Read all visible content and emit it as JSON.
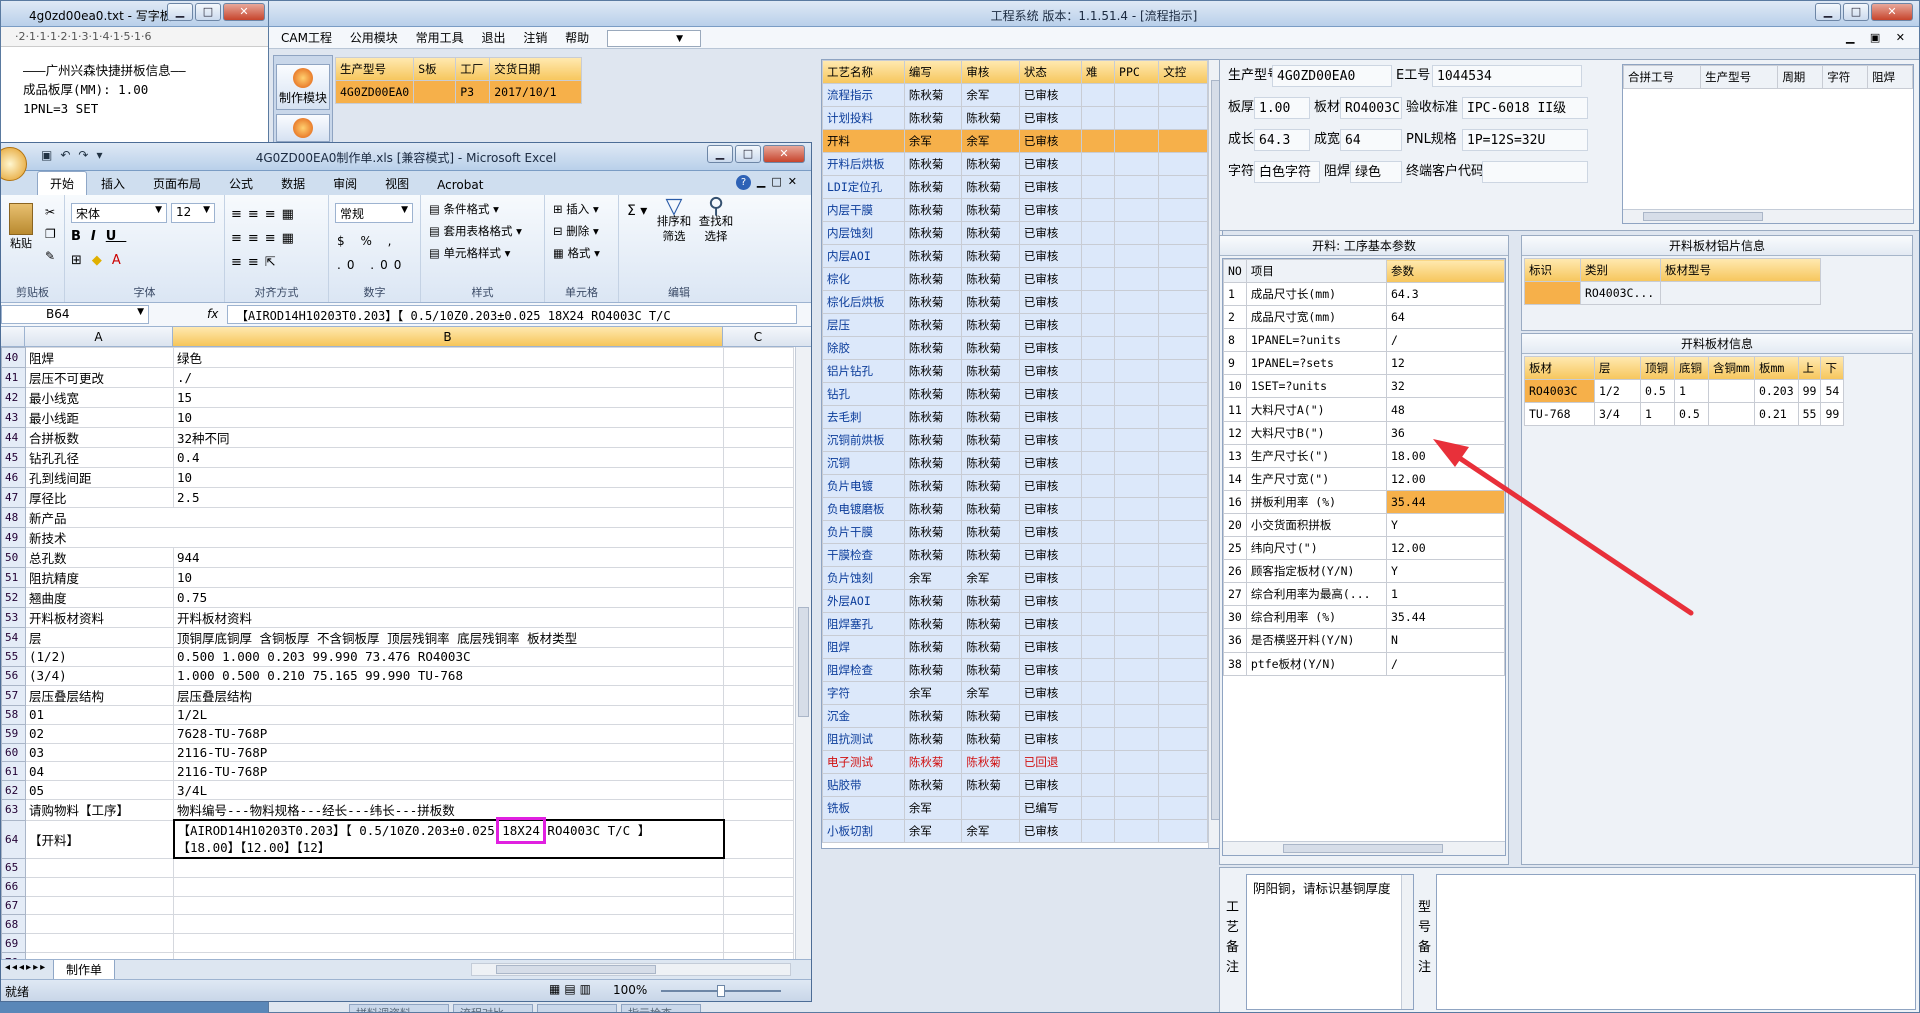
{
  "notepad": {
    "title": "4g0zd00ea0.txt - 写字板",
    "ruler": "·2·1·1·1·2·1·3·1·4·1·5·1·6",
    "lines": [
      "———广州兴森快捷拼板信息——",
      "成品板厚(MM): 1.00",
      "1PNL=3 SET"
    ]
  },
  "app": {
    "title": "工程系统   版本：1.1.51.4 - [流程指示]",
    "menu": [
      "CAM工程",
      "公用模块",
      "常用工具",
      "退出",
      "注销",
      "帮助"
    ],
    "side_btn": "制作模块",
    "jobs": {
      "headers": [
        "生产型号",
        "S板",
        "工厂",
        "交货日期"
      ],
      "row": [
        "4G0ZD00EA0",
        "",
        "P3",
        "2017/10/1"
      ]
    },
    "process": {
      "headers": [
        "工艺名称",
        "编写",
        "审核",
        "状态",
        "难",
        "PPC",
        "文控"
      ],
      "rows": [
        [
          "流程指示",
          "陈秋菊",
          "余军",
          "已审核"
        ],
        [
          "计划投料",
          "陈秋菊",
          "陈秋菊",
          "已审核"
        ],
        [
          "开料",
          "余军",
          "余军",
          "已审核"
        ],
        [
          "开料后烘板",
          "陈秋菊",
          "陈秋菊",
          "已审核"
        ],
        [
          "LDI定位孔",
          "陈秋菊",
          "陈秋菊",
          "已审核"
        ],
        [
          "内层干膜",
          "陈秋菊",
          "陈秋菊",
          "已审核"
        ],
        [
          "内层蚀刻",
          "陈秋菊",
          "陈秋菊",
          "已审核"
        ],
        [
          "内层AOI",
          "陈秋菊",
          "陈秋菊",
          "已审核"
        ],
        [
          "棕化",
          "陈秋菊",
          "陈秋菊",
          "已审核"
        ],
        [
          "棕化后烘板",
          "陈秋菊",
          "陈秋菊",
          "已审核"
        ],
        [
          "层压",
          "陈秋菊",
          "陈秋菊",
          "已审核"
        ],
        [
          "除胶",
          "陈秋菊",
          "陈秋菊",
          "已审核"
        ],
        [
          "铝片钻孔",
          "陈秋菊",
          "陈秋菊",
          "已审核"
        ],
        [
          "钻孔",
          "陈秋菊",
          "陈秋菊",
          "已审核"
        ],
        [
          "去毛刺",
          "陈秋菊",
          "陈秋菊",
          "已审核"
        ],
        [
          "沉铜前烘板",
          "陈秋菊",
          "陈秋菊",
          "已审核"
        ],
        [
          "沉铜",
          "陈秋菊",
          "陈秋菊",
          "已审核"
        ],
        [
          "负片电镀",
          "陈秋菊",
          "陈秋菊",
          "已审核"
        ],
        [
          "负电镀磨板",
          "陈秋菊",
          "陈秋菊",
          "已审核"
        ],
        [
          "负片干膜",
          "陈秋菊",
          "陈秋菊",
          "已审核"
        ],
        [
          "干膜检查",
          "陈秋菊",
          "陈秋菊",
          "已审核"
        ],
        [
          "负片蚀刻",
          "余军",
          "余军",
          "已审核"
        ],
        [
          "外层AOI",
          "陈秋菊",
          "陈秋菊",
          "已审核"
        ],
        [
          "阻焊塞孔",
          "陈秋菊",
          "陈秋菊",
          "已审核"
        ],
        [
          "阻焊",
          "陈秋菊",
          "陈秋菊",
          "已审核"
        ],
        [
          "阻焊检查",
          "陈秋菊",
          "陈秋菊",
          "已审核"
        ],
        [
          "字符",
          "余军",
          "余军",
          "已审核"
        ],
        [
          "沉金",
          "陈秋菊",
          "陈秋菊",
          "已审核"
        ],
        [
          "阻抗测试",
          "陈秋菊",
          "陈秋菊",
          "已审核"
        ],
        [
          "电子测试",
          "陈秋菊",
          "陈秋菊",
          "已回退"
        ],
        [
          "贴胶带",
          "陈秋菊",
          "陈秋菊",
          "已审核"
        ],
        [
          "铣板",
          "余军",
          "",
          "已编写"
        ],
        [
          "小板切割",
          "余军",
          "余军",
          "已审核"
        ]
      ]
    },
    "info": {
      "prod_model_label": "生产型号",
      "prod_model": "4G0ZD00EA0",
      "e_no_label": "E工号",
      "e_no": "1044534",
      "thick_label": "板厚",
      "thick": "1.00",
      "mat_label": "板材",
      "mat": "RO4003C",
      "std_label": "验收标准",
      "std": "IPC-6018 II级",
      "len_label": "成长",
      "len": "64.3",
      "wid_label": "成宽",
      "wid": "64",
      "pnl_label": "PNL规格",
      "pnl": "1P=12S=32U",
      "char_label": "字符",
      "char": "白色字符",
      "mask_label": "阻焊",
      "mask": "绿色",
      "cust_label": "终端客户代码",
      "cust": ""
    },
    "panelgrid": {
      "headers": [
        "合拼工号",
        "生产型号",
        "周期",
        "字符",
        "阻焊"
      ]
    },
    "params": {
      "title": "开料: 工序基本参数",
      "headers": [
        "NO",
        "项目",
        "参数"
      ],
      "rows": [
        [
          "1",
          "成品尺寸长(mm)",
          "64.3"
        ],
        [
          "2",
          "成品尺寸宽(mm)",
          "64"
        ],
        [
          "8",
          "1PANEL=?units",
          "/"
        ],
        [
          "9",
          "1PANEL=?sets",
          "12"
        ],
        [
          "10",
          "1SET=?units",
          "32"
        ],
        [
          "11",
          "大料尺寸A(\")",
          "48"
        ],
        [
          "12",
          "大料尺寸B(\")",
          "36"
        ],
        [
          "13",
          "生产尺寸长(\")",
          "18.00"
        ],
        [
          "14",
          "生产尺寸宽(\")",
          "12.00"
        ],
        [
          "16",
          "拼板利用率 (%)",
          "35.44"
        ],
        [
          "20",
          "小交货面积拼板",
          "Y"
        ],
        [
          "25",
          "纬向尺寸(\")",
          "12.00"
        ],
        [
          "26",
          "顾客指定板材(Y/N)",
          "Y"
        ],
        [
          "27",
          "综合利用率为最高(...",
          "1"
        ],
        [
          "30",
          "综合利用率 (%)",
          "35.44"
        ],
        [
          "36",
          "是否横竖开料(Y/N)",
          "N"
        ],
        [
          "38",
          "ptfe板材(Y/N)",
          "/"
        ]
      ]
    },
    "foil": {
      "title": "开料板材铝片信息",
      "headers": [
        "标识",
        "类别",
        "板材型号"
      ],
      "row": [
        "",
        "RO4003C...",
        ""
      ]
    },
    "sheet": {
      "title": "开料板材信息",
      "headers": [
        "板材",
        "层",
        "顶铜",
        "底铜",
        "含铜mm",
        "板mm",
        "上",
        "下"
      ],
      "rows": [
        [
          "RO4003C",
          "1/2",
          "0.5",
          "1",
          "",
          "0.203",
          "99",
          "54"
        ],
        [
          "TU-768",
          "3/4",
          "1",
          "0.5",
          "",
          "0.21",
          "55",
          "99"
        ]
      ]
    },
    "remark": {
      "label": "工艺备注",
      "text": "阴阳铜，请标识基铜厚度",
      "type_label": "型号备注"
    },
    "bottom_tabs": [
      "拼料调资料",
      "流程对比",
      "",
      "指示检查"
    ]
  },
  "excel": {
    "title": "4G0ZD00EA0制作单.xls  [兼容模式] - Microsoft Excel",
    "tabs": [
      "开始",
      "插入",
      "页面布局",
      "公式",
      "数据",
      "审阅",
      "视图",
      "Acrobat"
    ],
    "font": "宋体",
    "size": "12",
    "numfmt": "常规",
    "groups": [
      "剪贴板",
      "字体",
      "对齐方式",
      "数字",
      "样式",
      "单元格",
      "编辑"
    ],
    "style_items": [
      "条件格式",
      "套用表格格式",
      "单元格样式"
    ],
    "cell_items": [
      "插入",
      "删除",
      "格式"
    ],
    "edit_items": [
      "排序和筛选",
      "查找和选择"
    ],
    "paste": "粘贴",
    "namebox": "B64",
    "formula": "【AIROD14H10203T0.203】【 0.5/10Z0.203±0.025 18X24  RO4003C T/C",
    "cols": [
      "A",
      "B",
      "C"
    ],
    "rows": [
      [
        "40",
        "阻焊",
        "绿色"
      ],
      [
        "41",
        "层压不可更改",
        "./"
      ],
      [
        "42",
        "最小线宽",
        "15"
      ],
      [
        "43",
        "最小线距",
        "10"
      ],
      [
        "44",
        "合拼板数",
        "32种不同"
      ],
      [
        "45",
        "钻孔孔径",
        "0.4"
      ],
      [
        "46",
        "孔到线间距",
        "10"
      ],
      [
        "47",
        "厚径比",
        "2.5"
      ],
      [
        "48",
        "新产品",
        ""
      ],
      [
        "49",
        "新技术",
        ""
      ],
      [
        "50",
        "总孔数",
        "944"
      ],
      [
        "51",
        "阻抗精度",
        "10"
      ],
      [
        "52",
        "翘曲度",
        "0.75"
      ],
      [
        "53",
        "开料板材资料",
        "开料板材资料"
      ],
      [
        "54",
        "层",
        "顶铜厚底铜厚  含铜板厚  不含铜板厚  顶层残铜率  底层残铜率  板材类型"
      ],
      [
        "55",
        "(1/2)",
        "0.500  1.000       0.203      99.990      73.476      RO4003C"
      ],
      [
        "56",
        "(3/4)",
        "1.000  0.500       0.210      75.165      99.990      TU-768"
      ],
      [
        "57",
        "层压叠层结构",
        "层压叠层结构"
      ],
      [
        "58",
        "01",
        "1/2L"
      ],
      [
        "59",
        "02",
        "7628-TU-768P"
      ],
      [
        "60",
        "03",
        "2116-TU-768P"
      ],
      [
        "61",
        "04",
        "2116-TU-768P"
      ],
      [
        "62",
        "05",
        "3/4L"
      ],
      [
        "63",
        "请购物料【工序】",
        "物料编号---物料规格---经长---纬长---拼板数"
      ]
    ],
    "row64": {
      "num": "64",
      "a": "【开料】",
      "line1": "【AIROD14H10203T0.203】【 0.5/10Z0.203±0.025 ",
      "hl": "18X24",
      "line1b": "  RO4003C T/C 】",
      "line2": "【18.00】【12.00】【12】"
    },
    "empty_rows": [
      "65",
      "66",
      "67",
      "68",
      "69",
      "70"
    ],
    "sheet_tab": "制作单",
    "status": "就绪",
    "zoom": "100%"
  },
  "colors": {
    "orange_hdr": "#f6c55a",
    "selected": "#f6b04a",
    "title_blue": "#1b2a40",
    "highlight": "#e020e0",
    "arrow": "#e8303a"
  }
}
